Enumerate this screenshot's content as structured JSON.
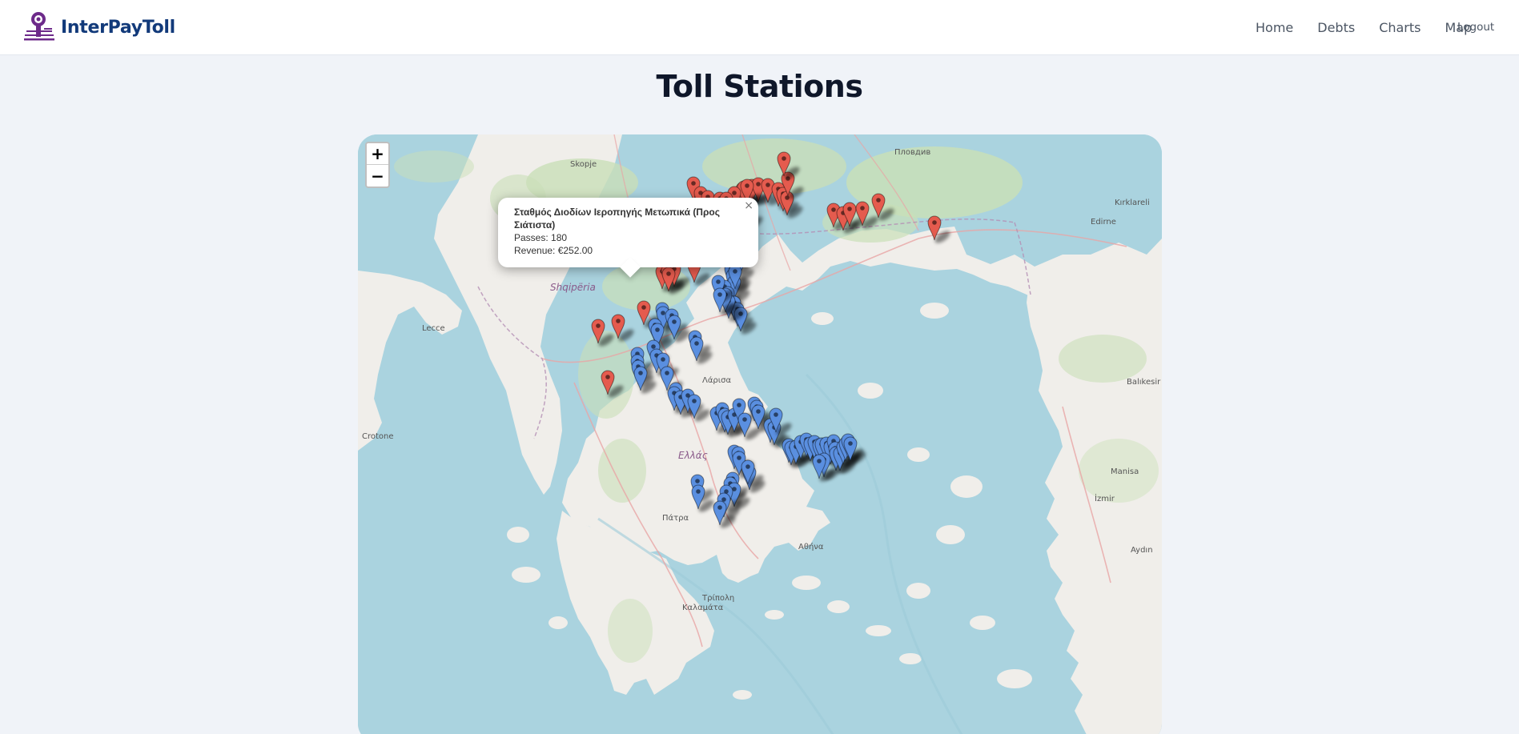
{
  "brand": {
    "name": "InterPayToll"
  },
  "nav": {
    "home": "Home",
    "debts": "Debts",
    "charts": "Charts",
    "map": "Map",
    "logout": "Logout"
  },
  "page": {
    "title": "Toll Stations"
  },
  "map": {
    "zoom_in": "+",
    "zoom_out": "−",
    "labels": {
      "albania": "Shqipëria",
      "greece": "Ελλάς",
      "athens": "Αθήνα",
      "patras": "Πάτρα",
      "larisa": "Λάρισα",
      "izmir": "İzmir",
      "balikesir": "Balıkesir",
      "edirne": "Edirne",
      "skopje": "Skopje",
      "plovdiv": "Пловдив",
      "lecce": "Lecce",
      "crotone": "Crotone",
      "aydin": "Aydın",
      "manisa": "Manisa",
      "kirklareli": "Kırklareli",
      "tripoli": "Τρίπολη",
      "kalamata": "Καλαμάτα"
    },
    "marker_colors": {
      "red": "#e55b4e",
      "blue": "#5a8fe0"
    },
    "red_marker_count": 36,
    "blue_marker_count": 85
  },
  "popup": {
    "title": "Σταθμός Διοδίων Ιεροπηγής Μετωπικά (Προς Σιάτιστα)",
    "passes": "Passes: 180",
    "revenue": "Revenue: €252.00",
    "close": "×"
  }
}
